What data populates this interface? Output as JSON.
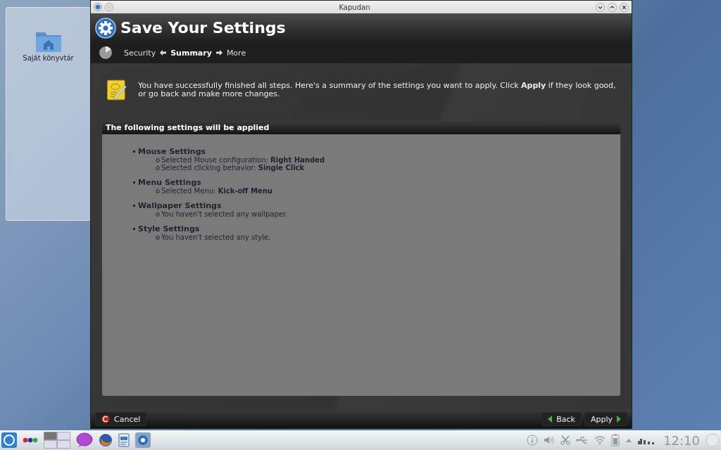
{
  "desktop": {
    "folder_view": {
      "items": [
        {
          "label": "Saját könyvtár"
        }
      ]
    }
  },
  "window": {
    "title": "Kapudan",
    "header": {
      "title": "Save Your Settings"
    },
    "steps": [
      {
        "label": "Security",
        "selected": false
      },
      {
        "label": "Summary",
        "selected": true
      },
      {
        "label": "More",
        "selected": false
      }
    ],
    "intro": "You have successfully finished all steps. Here's a summary of the settings you want to apply. Click **Apply** if they look good, or go back and make more changes.",
    "summary": {
      "title": "The following settings will be applied",
      "sections": [
        {
          "heading": "Mouse Settings",
          "items": [
            "Selected Mouse configuration: **Right Handed**",
            "Selected clicking behavior: **Single Click**"
          ]
        },
        {
          "heading": "Menu Settings",
          "items": [
            "Selected Menu: **Kick-off Menu**"
          ]
        },
        {
          "heading": "Wallpaper Settings",
          "items": [
            "You haven't selected any wallpaper."
          ]
        },
        {
          "heading": "Style Settings",
          "items": [
            "You haven't selected any style."
          ]
        }
      ]
    },
    "buttons": {
      "left": [
        {
          "label": "Cancel",
          "kind": "cancel"
        }
      ],
      "right": [
        {
          "label": "Back",
          "kind": "back"
        },
        {
          "label": "Apply",
          "kind": "apply"
        }
      ]
    }
  },
  "taskbar": {
    "clock": "12:10"
  }
}
